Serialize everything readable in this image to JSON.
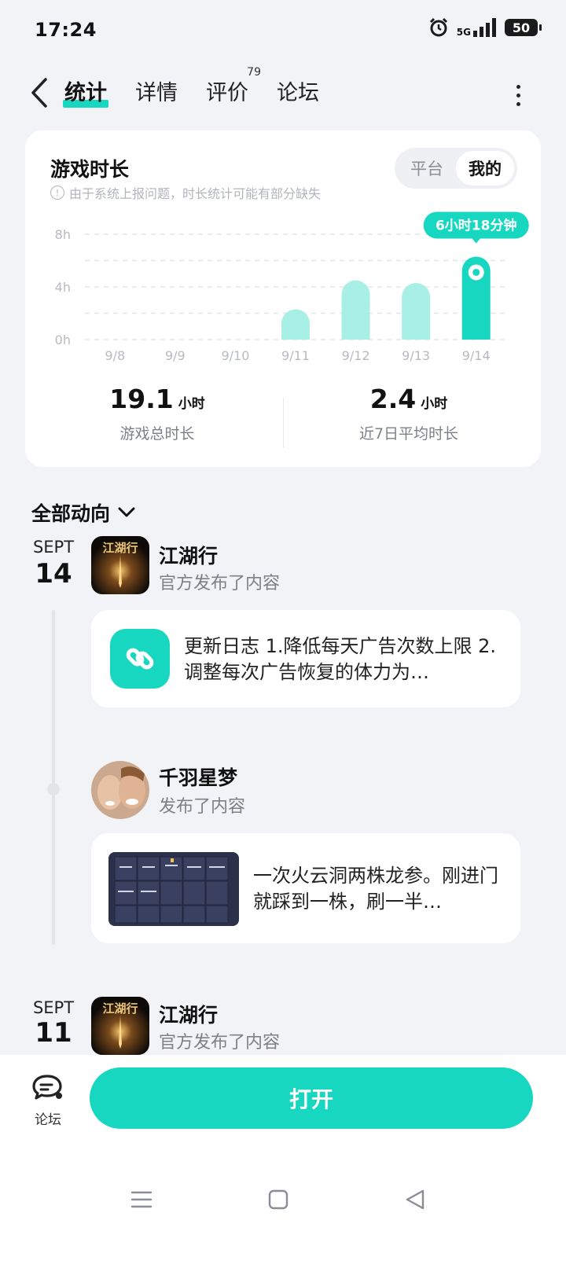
{
  "status_bar": {
    "time": "17:24",
    "network": "5G",
    "battery": "50"
  },
  "header": {
    "tabs": [
      {
        "label": "统计",
        "active": true
      },
      {
        "label": "详情",
        "active": false
      },
      {
        "label": "评价",
        "badge": "79",
        "active": false
      },
      {
        "label": "论坛",
        "active": false
      }
    ]
  },
  "stats_card": {
    "title": "游戏时长",
    "note": "由于系统上报问题，时长统计可能有部分缺失",
    "toggle": {
      "options": [
        "平台",
        "我的"
      ],
      "selected": "我的"
    },
    "total": {
      "value": "19.1",
      "unit": "小时",
      "label": "游戏总时长"
    },
    "average": {
      "value": "2.4",
      "unit": "小时",
      "label": "近7日平均时长"
    }
  },
  "chart_data": {
    "type": "bar",
    "categories": [
      "9/8",
      "9/9",
      "9/10",
      "9/11",
      "9/12",
      "9/13",
      "9/14"
    ],
    "values": [
      0,
      0,
      0,
      2.3,
      4.5,
      4.3,
      6.3
    ],
    "y_ticks": [
      "0h",
      "4h",
      "8h"
    ],
    "ylim": [
      0,
      8
    ],
    "highlight": {
      "category": "9/14",
      "label": "6小时18分钟"
    },
    "grid": true,
    "colors": {
      "bar": "#a8f0e6",
      "highlight": "#17d7c0"
    }
  },
  "feed": {
    "filter_label": "全部动向",
    "groups": [
      {
        "month": "SEPT",
        "day": "14",
        "entries": [
          {
            "name": "江湖行",
            "action": "官方发布了内容",
            "avatar_text": "江湖行",
            "post": {
              "icon": "link-icon",
              "text": "更新日志 1.降低每天广告次数上限 2.调整每次广告恢复的体力为…"
            }
          },
          {
            "name": "千羽星梦",
            "action": "发布了内容",
            "post": {
              "text": "一次火云洞两株龙参。刚进门就踩到一株，刷一半…"
            }
          }
        ]
      },
      {
        "month": "SEPT",
        "day": "11",
        "entries": [
          {
            "name": "江湖行",
            "action": "官方发布了内容",
            "avatar_text": "江湖行"
          }
        ]
      }
    ]
  },
  "bottom_bar": {
    "forum_label": "论坛",
    "open_label": "打开"
  },
  "colors": {
    "accent": "#17d7c0",
    "accent_light": "#a8f0e6",
    "background": "#f2f3f6"
  }
}
